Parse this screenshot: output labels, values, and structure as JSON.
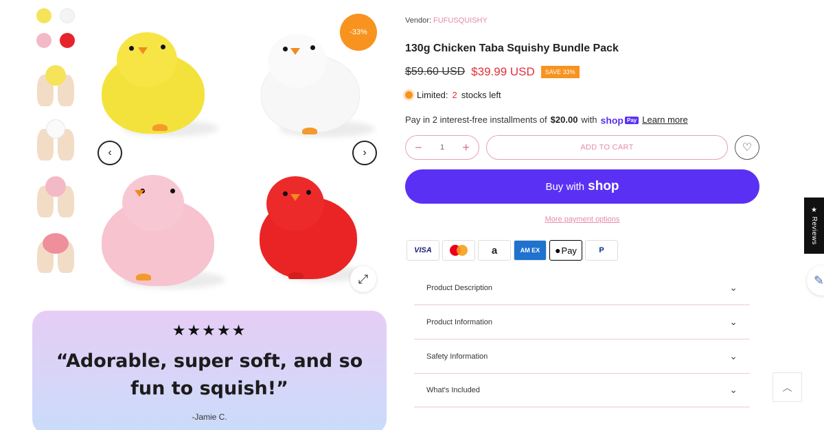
{
  "gallery": {
    "sale_badge": "-33%",
    "prev_icon": "‹",
    "next_icon": "›",
    "zoom_icon": "⤢",
    "thumbnails": [
      "all-colors",
      "yellow-in-hands",
      "white-in-hands",
      "pink-in-hands",
      "squished-in-hands"
    ]
  },
  "review": {
    "stars": "★★★★★",
    "quote": "“Adorable, super soft, and so fun to squish!”",
    "author": "-Jamie C."
  },
  "product": {
    "vendor_label": "Vendor:",
    "vendor_name": "FUFUSQUISHY",
    "title": "130g Chicken Taba Squishy Bundle Pack",
    "old_price": "$59.60 USD",
    "new_price": "$39.99 USD",
    "save_badge": "SAVE 33%",
    "stock_label": "Limited:",
    "stock_count": "2",
    "stock_suffix": "stocks left",
    "installments_prefix": "Pay in 2 interest-free installments of",
    "installments_amount": "$20.00",
    "installments_with": "with",
    "shoppay_label": "shop",
    "shoppay_badge": "Pay",
    "learn_more": "Learn more",
    "qty_minus": "−",
    "qty_value": "1",
    "qty_plus": "+",
    "add_to_cart": "ADD TO CART",
    "wishlist_icon": "♡",
    "buy_with": "Buy with",
    "buy_shop_logo": "shop",
    "more_payment": "More payment options"
  },
  "payment_cards": {
    "visa": "VISA",
    "amazon": "a",
    "amex": "AM EX",
    "apple": "Pay",
    "paypal": "P"
  },
  "accordion": [
    {
      "label": "Product Description",
      "icon": "⌄"
    },
    {
      "label": "Product Information",
      "icon": "⌄"
    },
    {
      "label": "Safety Information",
      "icon": "⌄"
    },
    {
      "label": "What's Included",
      "icon": "⌄"
    }
  ],
  "widgets": {
    "reviews_tab": "★ Reviews",
    "edit_icon": "✎",
    "back_to_top_icon": "︿"
  },
  "colors": {
    "accent_pink": "#e48aa8",
    "sale_orange": "#f7931e",
    "price_red": "#e0303a",
    "shop_purple": "#5a31f4"
  }
}
